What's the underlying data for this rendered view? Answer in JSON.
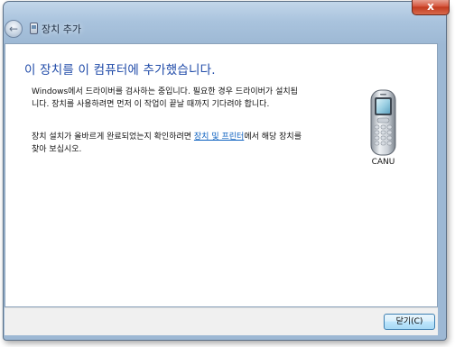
{
  "titlebar": {
    "close_glyph": "x"
  },
  "nav": {
    "back_glyph": "←",
    "title": "장치 추가"
  },
  "content": {
    "main_instruction": "이 장치를 이 컴퓨터에 추가했습니다.",
    "paragraph1": "Windows에서 드라이버를 검사하는 중입니다. 필요한 경우 드라이버가 설치됩니다. 장치를 사용하려면 먼저 이 작업이 끝날 때까지 기다려야 합니다.",
    "paragraph2_before": "장치 설치가 올바르게 완료되었는지 확인하려면 ",
    "paragraph2_link": "장치 및 프린터",
    "paragraph2_after": "에서 해당 장치를 찾아 보십시오."
  },
  "device": {
    "name": "CANU",
    "icon": "mobile-phone-icon"
  },
  "footer": {
    "close_label": "닫기(C)"
  }
}
